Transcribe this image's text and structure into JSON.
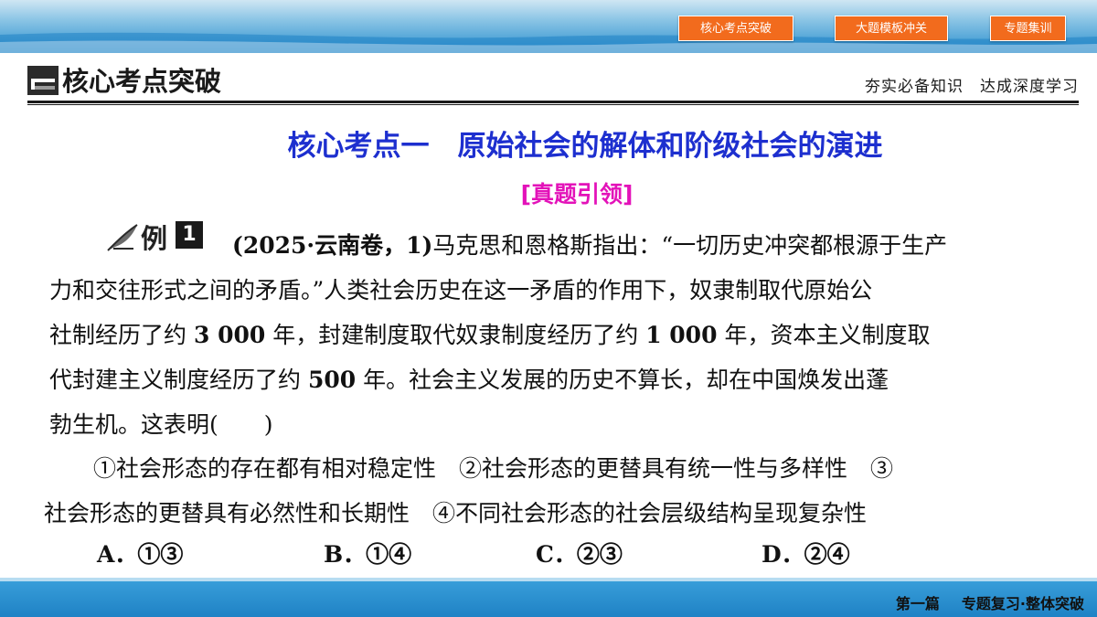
{
  "nav": {
    "btn1": "核心考点突破",
    "btn2": "大题模板冲关",
    "btn3": "专题集训"
  },
  "section": {
    "title": "核心考点突破",
    "subtitle": "夯实必备知识　达成深度学习"
  },
  "main_title": "核心考点一　原始社会的解体和阶级社会的演进",
  "sub_tag": "[真题引领]",
  "example": {
    "label": "例",
    "number": "1",
    "source": "(2025·云南卷，1)",
    "line1": "马克思和恩格斯指出：“一切历史冲突都根源于生产",
    "line2": "力和交往形式之间的矛盾。”人类社会历史在这一矛盾的作用下，奴隶制取代原始公",
    "line3_a": "社制经历了约",
    "line3_num1": "3 000",
    "line3_b": "年，封建制度取代奴隶制度经历了约",
    "line3_num2": "1 000",
    "line3_c": "年，资本主义制度取",
    "line4_a": "代封建主义制度经历了约",
    "line4_num": "500",
    "line4_b": "年。社会主义发展的历史不算长，却在中国焕发出蓬",
    "line5": "勃生机。这表明(　　)"
  },
  "statements": {
    "line1": "①社会形态的存在都有相对稳定性　②社会形态的更替具有统一性与多样性　③",
    "line2": "社会形态的更替具有必然性和长期性　④不同社会形态的社会层级结构呈现复杂性"
  },
  "choices": {
    "a": "A．①③",
    "b": "B．①④",
    "c": "C．②③",
    "d": "D．②④"
  },
  "footer": {
    "part": "第一篇",
    "topic": "专题复习·整体突破"
  },
  "colors": {
    "title_blue": "#1d2fcf",
    "tag_magenta": "#e312b9",
    "nav_orange": "#f26b1d",
    "bar_blue": "#1f82c5"
  }
}
